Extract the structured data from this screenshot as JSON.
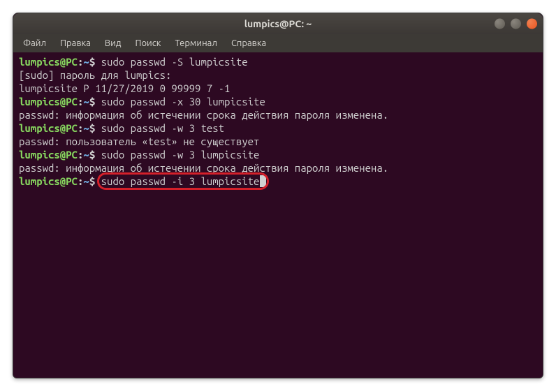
{
  "window": {
    "title": "lumpics@PC: ~"
  },
  "menu": {
    "file": "Файл",
    "edit": "Правка",
    "view": "Вид",
    "search": "Поиск",
    "terminal": "Терминал",
    "help": "Справка"
  },
  "prompt": {
    "user_host": "lumpics@PC",
    "colon": ":",
    "path": "~",
    "symbol": "$"
  },
  "lines": {
    "cmd1": "sudo passwd -S lumpicsite",
    "out1": "[sudo] пароль для lumpics:",
    "out2": "lumpicsite P 11/27/2019 0 99999 7 -1",
    "cmd2": "sudo passwd -x 30 lumpicsite",
    "out3": "passwd: информация об истечении срока действия пароля изменена.",
    "cmd3": "sudo passwd -w 3 test",
    "out4": "passwd: пользователь «test» не существует",
    "cmd4": "sudo passwd -w 3 lumpicsite",
    "out5": "passwd: информация об истечении срока действия пароля изменена.",
    "cmd5": "sudo passwd -i 3 lumpicsite"
  }
}
